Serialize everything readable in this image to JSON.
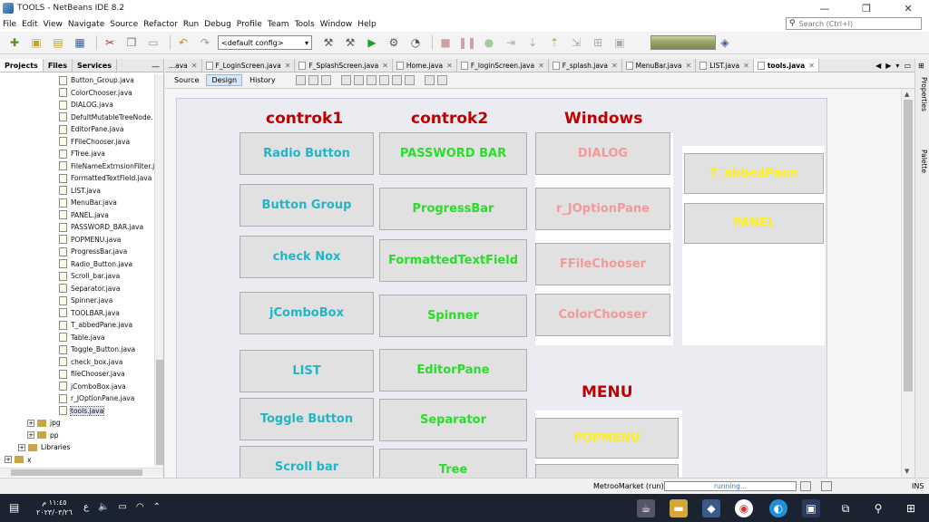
{
  "window": {
    "title": "TOOLS - NetBeans IDE 8.2",
    "controls": [
      "—",
      "❐",
      "✕"
    ]
  },
  "menu": {
    "items": [
      "File",
      "Edit",
      "View",
      "Navigate",
      "Source",
      "Refactor",
      "Run",
      "Debug",
      "Profile",
      "Team",
      "Tools",
      "Window",
      "Help"
    ],
    "search_placeholder": "Search (Ctrl+I)"
  },
  "toolbar": {
    "config": "<default config>"
  },
  "left_panel": {
    "tabs": [
      "Projects",
      "Files",
      "Services"
    ],
    "files": [
      "Button_Group.java",
      "ColorChooser.java",
      "DIALOG.java",
      "DefultMutableTreeNode.",
      "EditorPane.java",
      "FFileChooser.java",
      "FTree.java",
      "FileNameExtrnsionFilter.j",
      "FormattedTextField.java",
      "LIST.java",
      "MenuBar.java",
      "PANEL.java",
      "PASSWORD_BAR.java",
      "POPMENU.java",
      "ProgressBar.java",
      "Radio_Button.java",
      "Scroll_bar.java",
      "Separator.java",
      "Spinner.java",
      "TOOLBAR.java",
      "T_abbedPane.java",
      "Table.java",
      "Toggle_Button.java",
      "check_box.java",
      "fileChooser.java",
      "jComboBox.java",
      "r_JOptionPane.java",
      "tools.java"
    ],
    "nodes": [
      {
        "label": "jpg",
        "exp": "+"
      },
      {
        "label": "pp",
        "exp": "+"
      },
      {
        "label": "Libraries",
        "exp": "+"
      },
      {
        "label": "x",
        "exp": "+"
      }
    ]
  },
  "editor_tabs": [
    "...ava",
    "F_LoginScreen.java",
    "F_SplashScreen.java",
    "Home.java",
    "F_loginScreen.java",
    "F_splash.java",
    "MenuBar.java",
    "LIST.java",
    "tools.java"
  ],
  "design_bar": {
    "buttons": [
      "Source",
      "Design",
      "History"
    ]
  },
  "right_rail": [
    "Properties",
    "Palette"
  ],
  "form": {
    "titles": {
      "controls1": "controk1",
      "controls2": "controk2",
      "windows": "Windows",
      "menu": "MENU"
    },
    "col1": [
      "Radio Button",
      "Button Group",
      "check Nox",
      "jComboBox",
      "LIST",
      "Toggle Button",
      "Scroll bar"
    ],
    "col2": [
      "PASSWORD BAR",
      "ProgressBar",
      "FormattedTextField",
      "Spinner",
      "EditorPane",
      "Separator",
      "Tree"
    ],
    "col3": [
      "DIALOG",
      "r_JOptionPane",
      "FFileChooser",
      "ColorChooser"
    ],
    "col4": [
      "T_abbedPane",
      "PANEL"
    ],
    "menu_items": [
      "POPMENU"
    ],
    "colors": {
      "title": "#c00000",
      "cyan": "#22b5c7",
      "green": "#2bdc2b",
      "pink": "#f19a9a",
      "yellow": "#ffef1a"
    }
  },
  "status": {
    "project": "MetrooMarket (run)",
    "progress": "running...",
    "mode": "INS"
  },
  "taskbar": {
    "time": "١١:٤٥ م",
    "date": "٢٠٢٣/٠٣/٢٦",
    "lang": "ع"
  }
}
